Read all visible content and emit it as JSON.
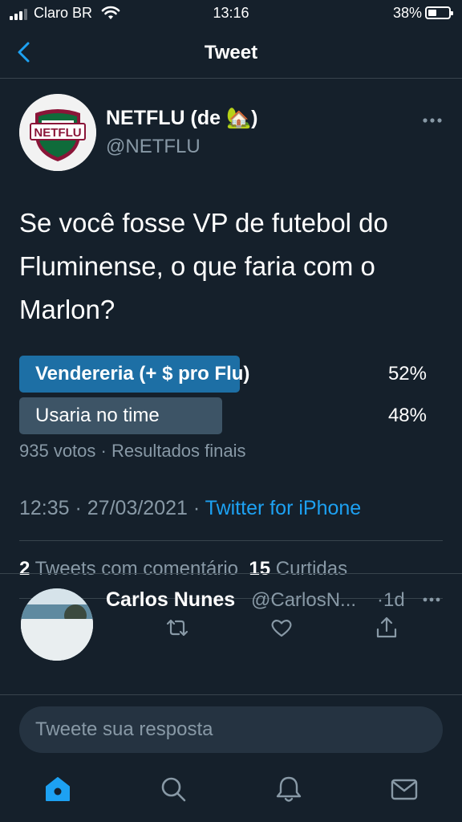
{
  "status_bar": {
    "carrier": "Claro BR",
    "time": "13:16",
    "battery": "38%",
    "battery_level": 0.38
  },
  "nav": {
    "title": "Tweet"
  },
  "tweet": {
    "avatar_text": "NETFLU",
    "author_name": "NETFLU (de ",
    "author_emoji": "🏡",
    "author_name_close": ")",
    "handle": "@NETFLU",
    "text": "Se você fosse VP de futebol do Fluminense, o que faria com o Marlon?",
    "poll": {
      "options": [
        {
          "label": "Vendereria (+ $ pro Flu)",
          "percent_text": "52%",
          "value": 0.52
        },
        {
          "label": "Usaria no time",
          "percent_text": "48%",
          "value": 0.48
        }
      ],
      "votes": "935 votos",
      "separator": " · ",
      "status": "Resultados finais"
    },
    "time": "12:35",
    "date": "27/03/2021",
    "source": "Twitter for iPhone",
    "quote_count": "2",
    "quote_label": "Tweets com comentário",
    "like_count": "15",
    "like_label": "Curtidas"
  },
  "reply": {
    "name": "Carlos Nunes",
    "handle": "@CarlosN...",
    "time": "·1d"
  },
  "compose": {
    "placeholder": "Tweete sua resposta"
  },
  "colors": {
    "background": "#15202b",
    "accent": "#1da1f2",
    "poll_winner": "#1d6fa5",
    "poll_other": "#3d5466",
    "secondary_text": "#8899a6"
  },
  "icons": {
    "nav_back": "chevron-left-icon",
    "actions": [
      "reply-icon",
      "retweet-icon",
      "like-icon",
      "share-icon"
    ],
    "tabs": [
      "home-icon",
      "search-icon",
      "notifications-icon",
      "messages-icon"
    ]
  }
}
